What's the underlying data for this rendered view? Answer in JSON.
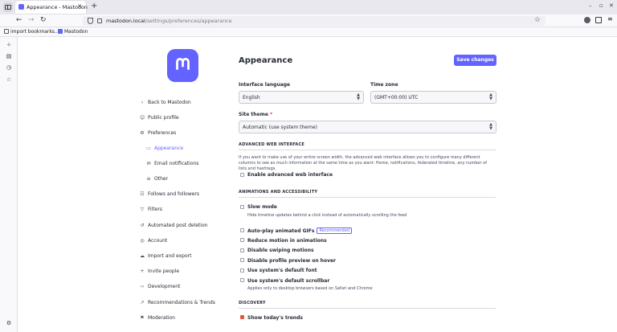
{
  "browser": {
    "tab_title": "Appearance - Mastodon",
    "url_host": "mastodon.local",
    "url_path": "/settings/preferences/appearance",
    "bookmarks": [
      "import bookmarks....",
      "Mastodon"
    ],
    "controls": {
      "minimize": "–",
      "maximize": "▫",
      "close": "✕",
      "new_tab": "+",
      "tab_close": "✕"
    }
  },
  "sidebar": {
    "items": [
      {
        "label": "Back to Mastodon",
        "icon": "chevron-left-icon"
      },
      {
        "label": "Public profile",
        "icon": "user-icon"
      },
      {
        "label": "Preferences",
        "icon": "cog-icon"
      },
      {
        "label": "Appearance",
        "icon": "desktop-icon",
        "active": true
      },
      {
        "label": "Email notifications",
        "icon": "envelope-icon"
      },
      {
        "label": "Other",
        "icon": "sliders-icon"
      },
      {
        "label": "Follows and followers",
        "icon": "users-icon"
      },
      {
        "label": "Filters",
        "icon": "filter-icon"
      },
      {
        "label": "Automated post deletion",
        "icon": "history-icon"
      },
      {
        "label": "Account",
        "icon": "lock-icon"
      },
      {
        "label": "Import and export",
        "icon": "cloud-icon"
      },
      {
        "label": "Invite people",
        "icon": "user-plus-icon"
      },
      {
        "label": "Development",
        "icon": "code-icon"
      },
      {
        "label": "Recommendations & Trends",
        "icon": "trends-icon"
      },
      {
        "label": "Moderation",
        "icon": "flag-icon"
      }
    ]
  },
  "main": {
    "title": "Appearance",
    "save_label": "Save changes",
    "interface_language": {
      "label": "Interface language",
      "value": "English"
    },
    "time_zone": {
      "label": "Time zone",
      "value": "(GMT+00:00) UTC"
    },
    "site_theme": {
      "label": "Site theme",
      "required_mark": "*",
      "value": "Automatic (use system theme)"
    },
    "advanced": {
      "heading": "ADVANCED WEB INTERFACE",
      "hint": "If you want to make use of your entire screen width, the advanced web interface allows you to configure many different columns to see as much information at the same time as you want: Home, notifications, federated timeline, any number of lists and hashtags.",
      "enable_label": "Enable advanced web interface"
    },
    "animations": {
      "heading": "ANIMATIONS AND ACCESSIBILITY",
      "slow_mode": "Slow mode",
      "slow_mode_hint": "Hide timeline updates behind a click instead of automatically scrolling the feed",
      "autoplay": "Auto-play animated GIFs",
      "recommended_badge": "Recommended",
      "reduce_motion": "Reduce motion in animations",
      "disable_swiping": "Disable swiping motions",
      "disable_hover": "Disable profile preview on hover",
      "system_font": "Use system's default font",
      "system_scrollbar": "Use system's default scrollbar",
      "scrollbar_hint": "Applies only to desktop browsers based on Safari and Chrome"
    },
    "discovery": {
      "heading": "DISCOVERY",
      "show_trends": "Show today's trends"
    }
  },
  "colors": {
    "accent": "#6364ff",
    "checkbox_checked": "#e8563a",
    "text": "#282c37"
  }
}
